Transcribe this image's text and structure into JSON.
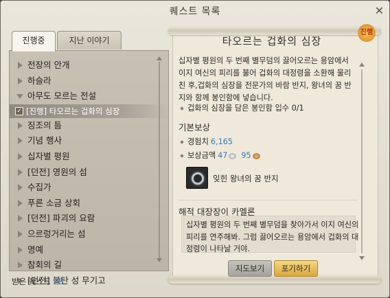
{
  "window": {
    "title": "퀘스트 목록"
  },
  "tabs": {
    "active": "진행중",
    "past": "지난 이야기"
  },
  "quest_list": {
    "items": [
      {
        "label": "전장의 안개",
        "expanded": false
      },
      {
        "label": "하슬라",
        "expanded": false
      },
      {
        "label": "아무도 모르는 전설",
        "expanded": true
      },
      {
        "label": "[진행] 타오르는 겁화의 심장",
        "sub": true,
        "checked": true
      },
      {
        "label": "징조의 틈",
        "expanded": false
      },
      {
        "label": "기념 행사",
        "expanded": false
      },
      {
        "label": "십자별 평원",
        "expanded": false
      },
      {
        "label": "[던전] 영원의 섬",
        "expanded": false
      },
      {
        "label": "수집가",
        "expanded": false
      },
      {
        "label": "푸른 소금 상회",
        "expanded": false
      },
      {
        "label": "[던전] 파괴의 요람",
        "expanded": false
      },
      {
        "label": "으르렁거리는 섬",
        "expanded": false
      },
      {
        "label": "명예",
        "expanded": false
      },
      {
        "label": "참회의 길",
        "expanded": false
      },
      {
        "label": "[던전] 불탄 성 무기고",
        "expanded": false
      }
    ],
    "received_label": "받은 퀘스트",
    "received_count": "28"
  },
  "detail": {
    "title": "타오르는 겁화의 심장",
    "badge": "진행",
    "description": "십자별 평원의 두 번째 별무덤의 끓어오르는 용암에서 이지 여신의 피리를 불어 겁화의 대정령을 소환해 물리친 후,겁화의 심장을 전문가의 바람 반지, 왕녀의 꿈 반지와 함께 봉인함에 넣습니다.",
    "objective": "겁화의 심장을 담은 봉인함 입수 0/1",
    "reward_section": "기본보상",
    "exp_label": "경험치",
    "exp_value": "6,165",
    "money_label": "보상금액",
    "money_silver": "47",
    "money_copper": "95",
    "reward_item": "잊힌 왕녀의 꿈 반지",
    "npc_name": "해적 대장장이 카멜론",
    "npc_text": "십자별 평원의 두 번째 별무덤을 찾아가서 이지 여신의 피리를 연주해봐. 그럼 끓어오르는 용암에서 겁화의 대정령이 나타날 거야.",
    "buttons": {
      "map": "지도보기",
      "abandon": "포기하기"
    }
  },
  "colors": {
    "accent_blue": "#3b78b7",
    "abandon_gold": "#e0b14d"
  }
}
